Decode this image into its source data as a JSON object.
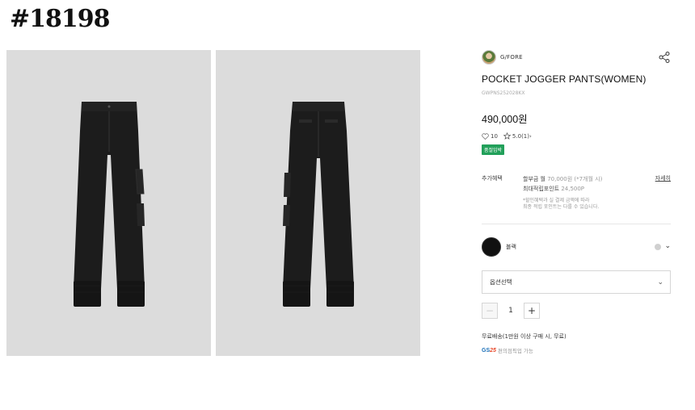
{
  "page_tag": "#18198",
  "gallery": {
    "images": [
      {
        "view": "front",
        "label": "Black cargo jogger pants front view"
      },
      {
        "view": "back",
        "label": "Black cargo jogger pants back view"
      }
    ]
  },
  "brand": {
    "name": "G/FORE"
  },
  "product": {
    "title": "POCKET JOGGER PANTS(WOMEN)",
    "code": "GWPNS252028KX",
    "price": "490,000원",
    "likes": "10",
    "rating": "5.0",
    "review_count": "(1)",
    "badge": "품절임박"
  },
  "benefits": {
    "label": "추가혜택",
    "installment_prefix": "할부금 월 ",
    "installment_value": "70,000원 (*7개월 시)",
    "points_prefix": "최대적립포인트 ",
    "points_value": "24,500P",
    "note_line1": "*할인혜택과 실 결제 금액에 따라",
    "note_line2": "최종 적립 포인트는 다를 수 있습니다.",
    "more_label": "자세히"
  },
  "color": {
    "name": "블랙",
    "swatch": "#111111",
    "alt_swatch": "#d0d0d0"
  },
  "option_select": {
    "label": "옵션선택"
  },
  "quantity": {
    "value": "1",
    "minus": "−",
    "plus": "+"
  },
  "shipping": {
    "text": "무료배송(1만원 이상 구매 시, 무료)"
  },
  "pickup": {
    "logo_gs": "GS",
    "logo_num": "25",
    "text": "편의점픽업 가능"
  }
}
